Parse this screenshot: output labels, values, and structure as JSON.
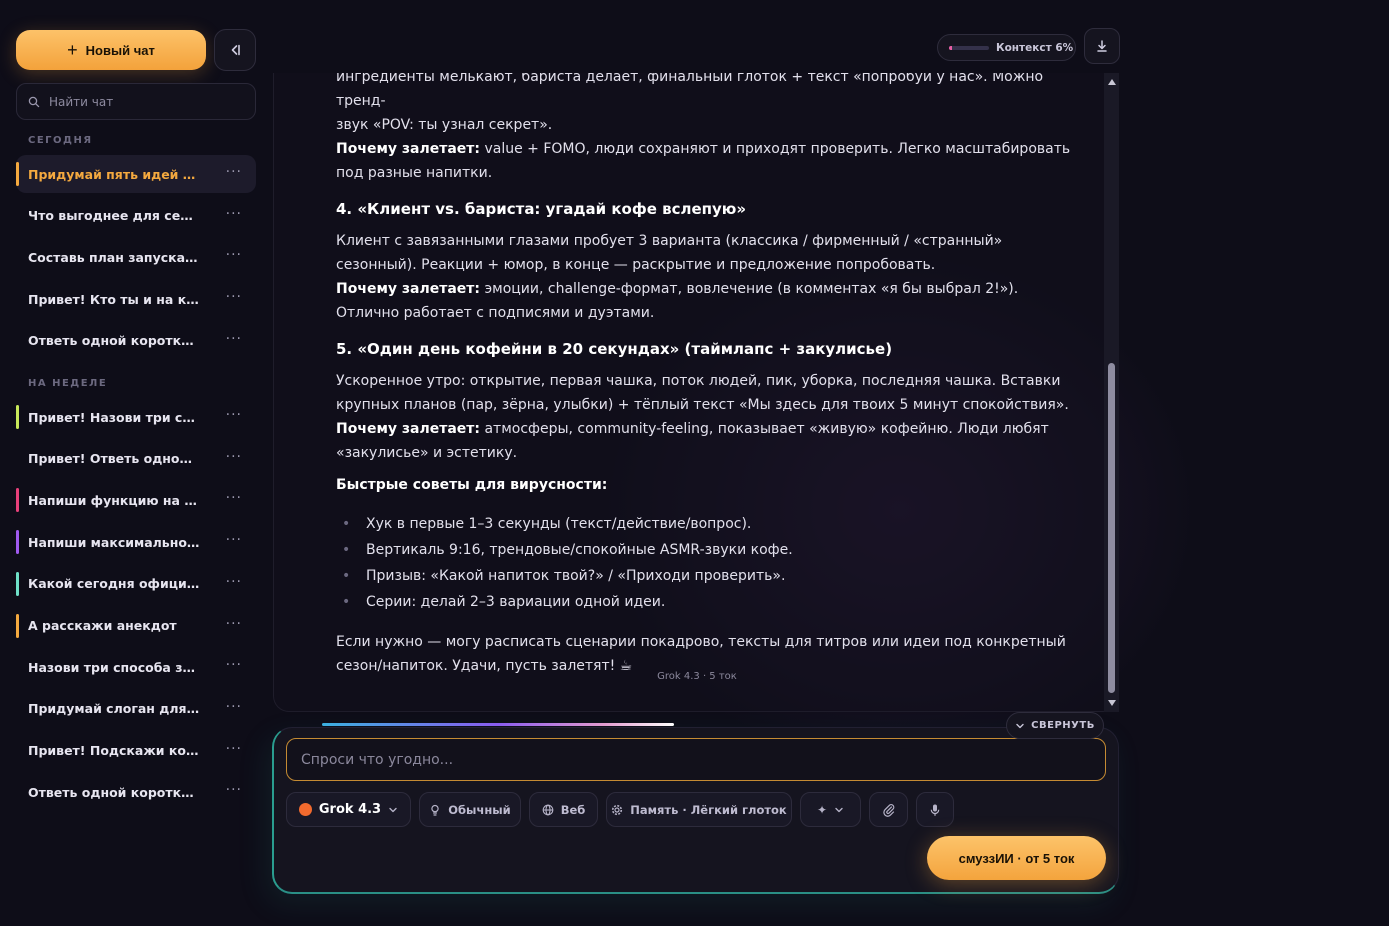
{
  "sidebar": {
    "new_chat_label": "Новый чат",
    "search_placeholder": "Найти чат",
    "sections": {
      "today": "СЕГОДНЯ",
      "week": "НА НЕДЕЛЕ"
    },
    "today_items": [
      {
        "label": "Придумай пять идей ко...",
        "active": true,
        "marker_color": "#f4a93f"
      },
      {
        "label": "Что выгоднее для семьи..."
      },
      {
        "label": "Составь план запуска м..."
      },
      {
        "label": "Привет! Кто ты и на как..."
      },
      {
        "label": "Ответь одной короткой ..."
      }
    ],
    "week_items": [
      {
        "label": "Привет! Назови три све...",
        "marker_color": "#c8e85a"
      },
      {
        "label": "Привет! Ответь одной ф..."
      },
      {
        "label": "Напиши функцию на Pyt...",
        "marker_color": "#e8407a"
      },
      {
        "label": "Напиши максимально п...",
        "marker_color": "#a05af0"
      },
      {
        "label": "Какой сегодня официал...",
        "marker_color": "#6fe0c8"
      },
      {
        "label": "А расскажи анекдот",
        "marker_color": "#f4a93f"
      },
      {
        "label": "Назови три способа зав..."
      },
      {
        "label": "Придумай слоган для с..."
      },
      {
        "label": "Привет! Подскажи коро..."
      },
      {
        "label": "Ответь одной короткой ..."
      }
    ],
    "item_menu_icon": "more-dots-icon"
  },
  "topbar": {
    "context_label": "Контекст 6%",
    "context_fraction": 0.06,
    "download_icon": "download-icon"
  },
  "message": {
    "intro_line_1": "ингредиенты мелькают, бариста делает, финальный глоток + текст «попробуй у нас». Можно тренд-",
    "intro_line_2": "звук «POV: ты узнал секрет».",
    "why_label": "Почему залетает:",
    "idea3_why": "value + FOMO, люди сохраняют и приходят проверить. Легко масштабировать под разные напитки.",
    "idea4_title": "4. «Клиент vs. бариста: угадай кофе вслепую»",
    "idea4_text": "Клиент с завязанными глазами пробует 3 варианта (классика / фирменный / «странный» сезонный). Реакции + юмор, в конце — раскрытие и предложение попробовать.",
    "idea4_why": "эмоции, challenge-формат, вовлечение (в комментах «я бы выбрал 2!»). Отлично работает с подписями и дуэтами.",
    "idea5_title": "5. «Один день кофейни в 20 секундах» (таймлапс + закулисье)",
    "idea5_text": "Ускоренное утро: открытие, первая чашка, поток людей, пик, уборка, последняя чашка. Вставки крупных планов (пар, зёрна, улыбки) + тёплый текст «Мы здесь для твоих 5 минут спокойствия».",
    "idea5_why": "атмосферы, community-feeling, показывает «живую» кофейню. Люди любят «закулисье» и эстетику.",
    "tips_title": "Быстрые советы для вирусности:",
    "tips": [
      "Хук в первые 1–3 секунды (текст/действие/вопрос).",
      "Вертикаль 9:16, трендовые/спокойные ASMR-звуки кофе.",
      "Призыв: «Какой напиток твой?» / «Приходи проверить».",
      "Серии: делай 2–3 вариации одной идеи."
    ],
    "closing": "Если нужно — могу расписать сценарии покадрово, тексты для титров или идеи под конкретный сезон/напиток. Удачи, пусть залетят! ☕",
    "meta": "Grok 4.3 · 5 ток"
  },
  "composer": {
    "collapse_label": "СВЕРНУТЬ",
    "placeholder": "Спроси что угодно...",
    "value": "",
    "model_label": "Grok 4.3",
    "mode_label": "Обычный",
    "web_label": "Веб",
    "memory_label": "Память · Лёгкий глоток",
    "send_label": "смуззИИ · от 5 ток",
    "colors": {
      "accent": "#f4a43d",
      "model_dot": "#f26a2e"
    }
  }
}
